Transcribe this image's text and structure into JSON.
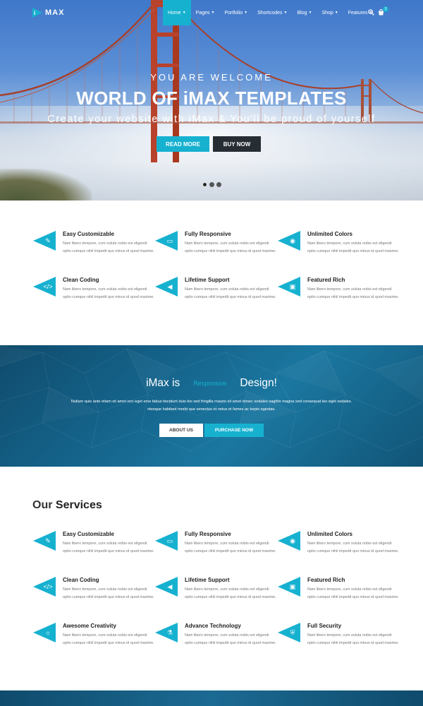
{
  "colors": {
    "accent": "#17b1d0",
    "dark": "#262d33",
    "band": "#15648c"
  },
  "logo": {
    "mark": "i",
    "text": "MAX"
  },
  "nav": {
    "items": [
      {
        "label": "Home",
        "active": true
      },
      {
        "label": "Pages"
      },
      {
        "label": "Portfolio"
      },
      {
        "label": "Shortcodes"
      },
      {
        "label": "Blog"
      },
      {
        "label": "Shop"
      },
      {
        "label": "Features"
      }
    ],
    "cart_count": "3"
  },
  "hero": {
    "subtitle": "YOU ARE WELCOME",
    "title": "WORLD OF iMAX TEMPLATES",
    "tagline": "Create your website with iMax & You'll be proud of yourself",
    "btn_read": "READ MORE",
    "btn_buy": "BUY NOW",
    "slides": 3,
    "active_slide": 1
  },
  "features": [
    {
      "icon": "edit-icon",
      "title": "Easy Customizable",
      "text": "Nam libero tempore, cum soluta nobis est eligendi optio cumque nihil impedit quo minus id quod maxime."
    },
    {
      "icon": "laptop-icon",
      "title": "Fully Responsive",
      "text": "Nam libero tempore, cum soluta nobis est eligendi optio cumque nihil impedit quo minus id quod maxime."
    },
    {
      "icon": "paint-bucket-icon",
      "title": "Unlimited Colors",
      "text": "Nam libero tempore, cum soluta nobis est eligendi optio cumque nihil impedit quo minus id quod maxime."
    },
    {
      "icon": "code-icon",
      "title": "Clean Coding",
      "text": "Nam libero tempore, cum soluta nobis est eligendi optio cumque nihil impedit quo minus id quod maxime."
    },
    {
      "icon": "megaphone-icon",
      "title": "Lifetime Support",
      "text": "Nam libero tempore, cum soluta nobis est eligendi optio cumque nihil impedit quo minus id quod maxime."
    },
    {
      "icon": "gift-icon",
      "title": "Featured Rich",
      "text": "Nam libero tempore, cum soluta nobis est eligendi optio cumque nihil impedit quo minus id quod maxime."
    }
  ],
  "band": {
    "word1": "iMax is",
    "word2": "Responsive",
    "word3": "Design!",
    "text": "Nullam quis ante etiam sit amet orci eget eros fabus tincidunt duis leo sed fringilla mauris sit amet donec sodales sagittis magna sed consequat leo eget sodales. ntesque habitant morbi que senectus et netus et fames ac turpis egestas.",
    "btn_about": "ABOUT US",
    "btn_purchase": "PURCHASE NOW"
  },
  "services": {
    "heading_light": "Our",
    "heading_bold": "Services",
    "items": [
      {
        "icon": "edit-icon",
        "title": "Easy Customizable",
        "text": "Nam libero tempore, cum soluta nobis est eligendi optio cumque nihil impedit quo minus id quod maxime."
      },
      {
        "icon": "laptop-icon",
        "title": "Fully Responsive",
        "text": "Nam libero tempore, cum soluta nobis est eligendi optio cumque nihil impedit quo minus id quod maxime."
      },
      {
        "icon": "paint-bucket-icon",
        "title": "Unlimited Colors",
        "text": "Nam libero tempore, cum soluta nobis est eligendi optio cumque nihil impedit quo minus id quod maxime."
      },
      {
        "icon": "code-icon",
        "title": "Clean Coding",
        "text": "Nam libero tempore, cum soluta nobis est eligendi optio cumque nihil impedit quo minus id quod maxime."
      },
      {
        "icon": "megaphone-icon",
        "title": "Lifetime Support",
        "text": "Nam libero tempore, cum soluta nobis est eligendi optio cumque nihil impedit quo minus id quod maxime."
      },
      {
        "icon": "gift-icon",
        "title": "Featured Rich",
        "text": "Nam libero tempore, cum soluta nobis est eligendi optio cumque nihil impedit quo minus id quod maxime."
      },
      {
        "icon": "lightbulb-icon",
        "title": "Awesome Creativity",
        "text": "Nam libero tempore, cum soluta nobis est eligendi optio cumque nihil impedit quo minus id quod maxime."
      },
      {
        "icon": "flask-icon",
        "title": "Advance Technology",
        "text": "Nam libero tempore, cum soluta nobis est eligendi optio cumque nihil impedit quo minus id quod maxime."
      },
      {
        "icon": "shield-icon",
        "title": "Full Security",
        "text": "Nam libero tempore, cum soluta nobis est eligendi optio cumque nihil impedit quo minus id quod maxime."
      }
    ]
  }
}
